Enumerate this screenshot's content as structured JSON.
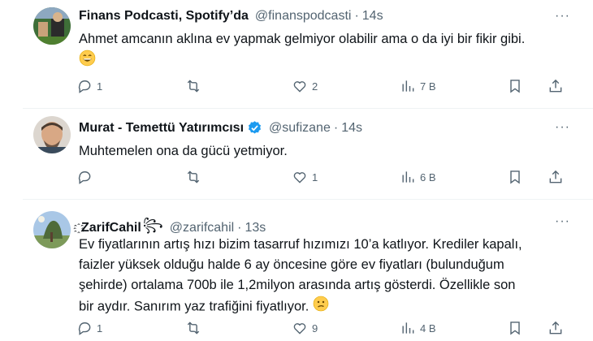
{
  "tweets": [
    {
      "name": "Finans Podcasti, Spotify’da",
      "handle": "@finanspodcasti",
      "time": "14s",
      "text": "Ahmet amcanın aklına ev yapmak gelmiyor olabilir ama o da iyi bir fikir gibi.",
      "emoji": "grinning-face",
      "replies": "1",
      "retweets": "",
      "likes": "2",
      "views": "7 B"
    },
    {
      "name": "Murat - Temettü Yatırımcısı",
      "handle": "@sufizane",
      "time": "14s",
      "text": "Muhtemelen ona da gücü yetmiyor.",
      "verified": true,
      "replies": "",
      "retweets": "",
      "likes": "1",
      "views": "6 B"
    },
    {
      "name_prefix": "҈",
      "name": "ZarifCahil",
      "name_suffix": "꧂",
      "handle": "@zarifcahil",
      "time": "13s",
      "text_lines": [
        "Ev fiyatlarının artış hızı bizim tasarruf hızımızı 10’a katlıyor. Krediler kapalı,",
        "faizler yüksek olduğu halde 6 ay öncesine göre ev fiyatları (bulunduğum",
        "şehirde) ortalama 700b ile 1,2milyon arasında artış gösterdi. Özellikle son",
        "bir aydır. Sanırım yaz trafiğini fiyatlıyor."
      ],
      "emoji": "confused-face",
      "replies": "1",
      "retweets": "",
      "likes": "9",
      "views": "4 B"
    }
  ],
  "more_label": "···",
  "colors": {
    "text": "#0f1419",
    "secondary": "#536471",
    "verified": "#1d9bf0",
    "divider": "#eff3f4"
  }
}
